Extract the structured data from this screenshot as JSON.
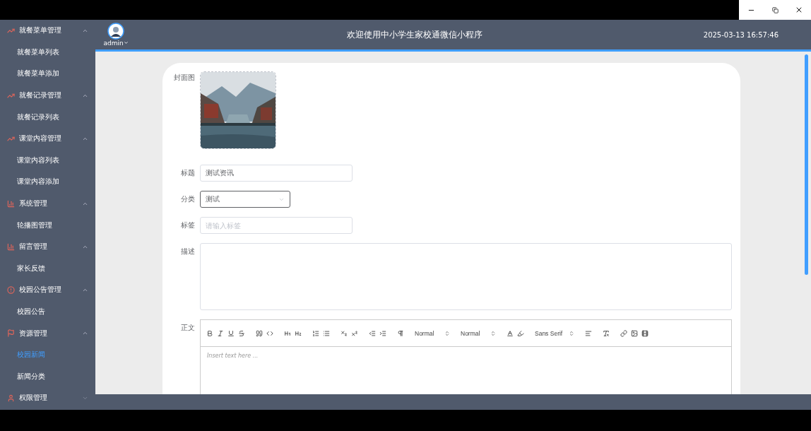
{
  "header": {
    "user": "admin",
    "title": "欢迎使用中小学生家校通微信小程序",
    "datetime": "2025-03-13 16:57:46"
  },
  "sidebar": {
    "groups": [
      {
        "label": "就餐菜单管理",
        "expanded": true,
        "children": [
          {
            "label": "就餐菜单列表",
            "selected": false
          },
          {
            "label": "就餐菜单添加",
            "selected": false
          }
        ]
      },
      {
        "label": "就餐记录管理",
        "expanded": true,
        "children": [
          {
            "label": "就餐记录列表",
            "selected": false
          }
        ]
      },
      {
        "label": "课堂内容管理",
        "expanded": true,
        "children": [
          {
            "label": "课堂内容列表",
            "selected": false
          },
          {
            "label": "课堂内容添加",
            "selected": false
          }
        ]
      },
      {
        "label": "系统管理",
        "expanded": true,
        "children": [
          {
            "label": "轮播图管理",
            "selected": false
          }
        ]
      },
      {
        "label": "留言管理",
        "expanded": true,
        "children": [
          {
            "label": "家长反馈",
            "selected": false
          }
        ]
      },
      {
        "label": "校园公告管理",
        "expanded": true,
        "children": [
          {
            "label": "校园公告",
            "selected": false
          }
        ]
      },
      {
        "label": "资源管理",
        "expanded": true,
        "children": [
          {
            "label": "校园新闻",
            "selected": true
          },
          {
            "label": "新闻分类",
            "selected": false
          }
        ]
      },
      {
        "label": "权限管理",
        "expanded": false
      }
    ]
  },
  "form": {
    "cover": {
      "label": "封面图"
    },
    "title": {
      "label": "标题",
      "value": "测试资讯"
    },
    "category": {
      "label": "分类",
      "value": "测试"
    },
    "tags": {
      "label": "标签",
      "placeholder": "请输入标签"
    },
    "description": {
      "label": "描述"
    },
    "body": {
      "label": "正文",
      "pickers": [
        "Normal",
        "Normal",
        "Sans Serif"
      ],
      "placeholder": "Insert text here ..."
    }
  }
}
